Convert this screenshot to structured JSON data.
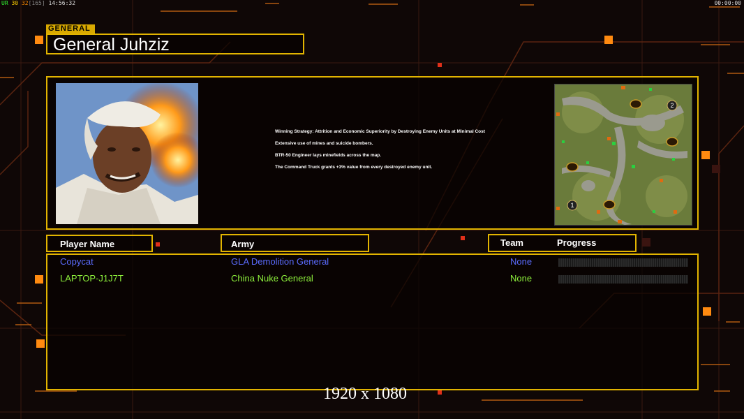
{
  "status_bar": {
    "fps_label": "UR",
    "fps_a": "30",
    "fps_b": "32",
    "fps_c": "[165]",
    "clock": "14:56:32",
    "timer": "00:00:00"
  },
  "general": {
    "tag": "GENERAL",
    "name": "General Juhziz"
  },
  "strategy": {
    "lines": [
      "Winning Strategy: Attrition and Economic Superiority by Destroying Enemy Units at Minimal Cost",
      "Extensive use of mines and suicide bombers.",
      "BTR-50 Engineer lays minefields across the map.",
      "The Command Truck grants +3% value from every destroyed enemy unit."
    ]
  },
  "headers": {
    "player_name": "Player Name",
    "army": "Army",
    "team": "Team",
    "progress": "Progress"
  },
  "players": [
    {
      "name": "Copycat",
      "army": "GLA Demolition General",
      "team": "None",
      "color": "#5b6cff",
      "progress": 0
    },
    {
      "name": "LAPTOP-J1J7T",
      "army": "China Nuke General",
      "team": "None",
      "color": "#8df03c",
      "progress": 0
    }
  ],
  "minimap": {
    "start_labels": [
      "1",
      "2"
    ]
  },
  "resolution_label": "1920 x 1080",
  "colors": {
    "accent": "#e2b400",
    "orange": "#ff7a00"
  }
}
